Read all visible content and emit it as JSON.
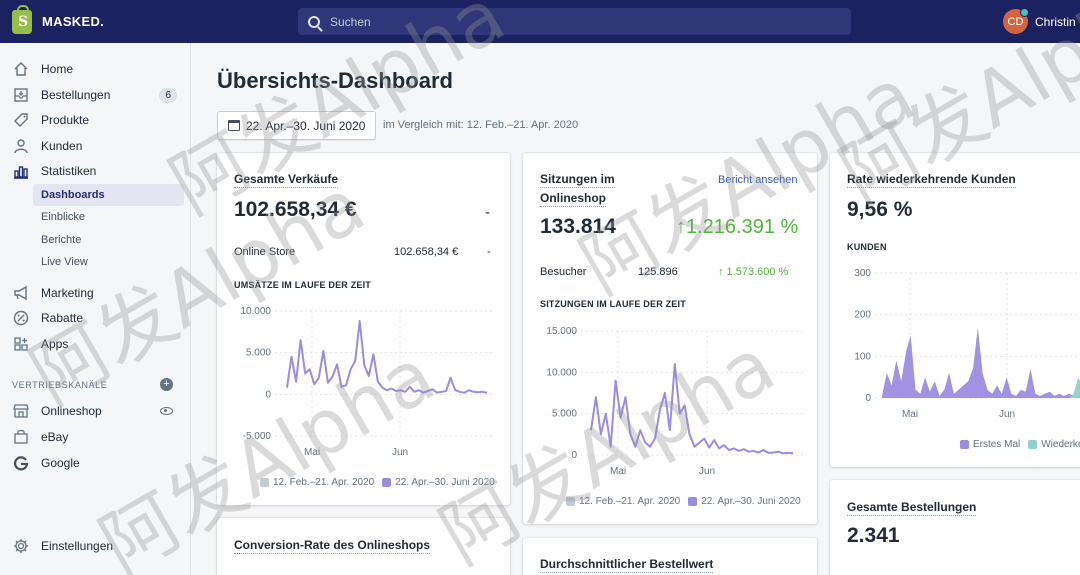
{
  "topbar": {
    "logo_letter": "S",
    "shop_name": "MASKED.",
    "search_placeholder": "Suchen",
    "user_initials": "CD",
    "user_name": "Christin"
  },
  "sidebar": {
    "items": [
      {
        "label": "Home",
        "icon": "home-icon"
      },
      {
        "label": "Bestellungen",
        "icon": "orders-icon",
        "badge": "6"
      },
      {
        "label": "Produkte",
        "icon": "tag-icon"
      },
      {
        "label": "Kunden",
        "icon": "person-icon"
      },
      {
        "label": "Statistiken",
        "icon": "bar-chart-icon"
      }
    ],
    "stats_sub": [
      "Dashboards",
      "Einblicke",
      "Berichte",
      "Live View"
    ],
    "items2": [
      {
        "label": "Marketing",
        "icon": "megaphone-icon"
      },
      {
        "label": "Rabatte",
        "icon": "discount-icon"
      },
      {
        "label": "Apps",
        "icon": "apps-icon"
      }
    ],
    "channels_title": "VERTRIEBSKANÄLE",
    "channels": [
      {
        "label": "Onlineshop",
        "icon": "store-icon"
      },
      {
        "label": "eBay",
        "icon": "bag-icon"
      },
      {
        "label": "Google",
        "icon": "google-icon"
      }
    ],
    "settings_label": "Einstellungen"
  },
  "main": {
    "title": "Übersichts-Dashboard",
    "date_range": "22. Apr.–30. Juni 2020",
    "compare_text": "im Vergleich mit: 12. Feb.–21. Apr. 2020"
  },
  "cards": {
    "sales": {
      "title": "Gesamte Verkäufe",
      "value": "102.658,34 €",
      "prev": "-",
      "row_label": "Online Store",
      "row_value": "102.658,34 €",
      "row_prev": "-",
      "chart_title": "UMSÄTZE IM LAUFE DER ZEIT",
      "legend_prev": "12. Feb.–21. Apr. 2020",
      "legend_curr": "22. Apr.–30. Juni 2020"
    },
    "sessions": {
      "title_line1": "Sitzungen im",
      "title_line2": "Onlineshop",
      "link": "Bericht ansehen",
      "value": "133.814",
      "change": "↑1.216.391 %",
      "row_label": "Besucher",
      "row_value": "125.896",
      "row_change": "↑ 1.573.600 %",
      "chart_title": "SITZUNGEN IM LAUFE DER ZEIT",
      "legend_prev": "12. Feb.–21. Apr. 2020",
      "legend_curr": "22. Apr.–30. Juni 2020"
    },
    "returning": {
      "title": "Rate wiederkehrende Kunden",
      "value": "9,56 %",
      "chart_title": "KUNDEN",
      "legend_first": "Erstes Mal",
      "legend_return": "Wiederke"
    },
    "orders": {
      "title": "Gesamte Bestellungen",
      "value": "2.341"
    },
    "conversion": {
      "title": "Conversion-Rate des Onlineshops"
    },
    "aov": {
      "title": "Durchschnittlicher Bestellwert"
    }
  },
  "colors": {
    "topbar": "#1c2260",
    "series_current": "#9c8ce0",
    "series_previous": "#c4cdd5",
    "series_return": "#8ed3cf"
  },
  "watermark": [
    "阿发Alpha",
    "阿发Alpha",
    "阿发Alpha",
    "阿发Alpha",
    "阿发Alpha",
    "阿发Alpha"
  ],
  "chart_data": [
    {
      "type": "line",
      "title": "UMSÄTZE IM LAUFE DER ZEIT",
      "ylim": [
        -5000,
        10000
      ],
      "yticks": [
        "10.000",
        "5.000",
        "0",
        "-5.000"
      ],
      "xticks": [
        "Mai",
        "Jun"
      ],
      "series": [
        {
          "name": "22. Apr.–30. Juni 2020",
          "values": [
            800,
            4500,
            1500,
            6500,
            2500,
            3000,
            1200,
            2000,
            5200,
            1400,
            2100,
            3600,
            900,
            1100,
            3000,
            4000,
            8800,
            3500,
            2200,
            4800,
            1500,
            800,
            500,
            700,
            400,
            500,
            300,
            900,
            300,
            500,
            200,
            400,
            600,
            200,
            300,
            400,
            2000,
            500,
            300,
            200,
            500,
            300,
            250,
            300,
            200
          ]
        },
        {
          "name": "12. Feb.–21. Apr. 2020",
          "values": []
        }
      ]
    },
    {
      "type": "line",
      "title": "SITZUNGEN IM LAUFE DER ZEIT",
      "ylim": [
        0,
        15000
      ],
      "yticks": [
        "15.000",
        "10.000",
        "5.000",
        "0"
      ],
      "xticks": [
        "Mai",
        "Jun"
      ],
      "series": [
        {
          "name": "22. Apr.–30. Juni 2020",
          "values": [
            3000,
            7000,
            2500,
            5000,
            1000,
            9000,
            4500,
            7000,
            2500,
            1000,
            3000,
            1500,
            1000,
            2000,
            5500,
            7500,
            3000,
            11000,
            5000,
            6000,
            2500,
            1000,
            1500,
            2000,
            900,
            1800,
            800,
            1200,
            600,
            800,
            500,
            700,
            400,
            500,
            300,
            600,
            250,
            300,
            400,
            200,
            250,
            200
          ]
        },
        {
          "name": "12. Feb.–21. Apr. 2020",
          "values": []
        }
      ]
    },
    {
      "type": "area",
      "title": "KUNDEN",
      "ylim": [
        0,
        300
      ],
      "yticks": [
        "300",
        "200",
        "100",
        "0"
      ],
      "xticks": [
        "Mai",
        "Jun"
      ],
      "series": [
        {
          "name": "Erstes Mal",
          "values": [
            5,
            60,
            30,
            90,
            40,
            110,
            150,
            20,
            10,
            50,
            15,
            40,
            5,
            20,
            60,
            10,
            20,
            30,
            40,
            70,
            170,
            60,
            20,
            10,
            30,
            10,
            50,
            10,
            5,
            20,
            15,
            70,
            10,
            5,
            10,
            15,
            5,
            10,
            5,
            10,
            5,
            5,
            5,
            5
          ]
        },
        {
          "name": "Wiederkehrend",
          "values": [
            0,
            0,
            0,
            0,
            0,
            0,
            0,
            0,
            0,
            0,
            0,
            0,
            0,
            0,
            0,
            0,
            0,
            0,
            0,
            0,
            0,
            0,
            0,
            0,
            0,
            0,
            0,
            0,
            0,
            0,
            0,
            0,
            0,
            0,
            0,
            0,
            0,
            0,
            0,
            0,
            10,
            50,
            20,
            5
          ]
        }
      ]
    }
  ]
}
